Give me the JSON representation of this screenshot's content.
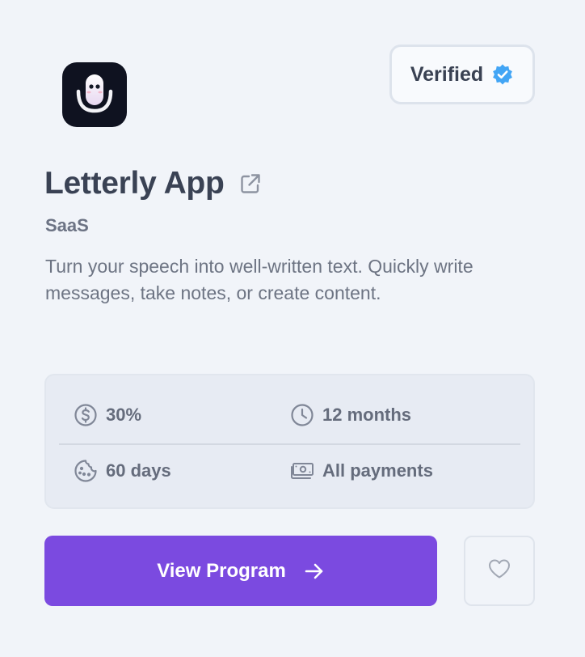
{
  "app": {
    "name": "Letterly App",
    "category": "SaaS",
    "description": "Turn your speech into well-written text. Quickly write messages, take notes, or create content.",
    "icon": "microphone-face-logo"
  },
  "badge": {
    "label": "Verified",
    "icon": "verified-check-icon",
    "icon_color": "#42a5f5"
  },
  "stats": {
    "commission": {
      "icon": "dollar-icon",
      "value": "30%"
    },
    "duration": {
      "icon": "clock-icon",
      "value": "12 months"
    },
    "cookie": {
      "icon": "cookie-icon",
      "value": "60 days"
    },
    "payments": {
      "icon": "cash-icon",
      "value": "All payments"
    }
  },
  "actions": {
    "view_label": "View Program",
    "view_icon": "arrow-right-icon",
    "fav_icon": "heart-icon"
  },
  "colors": {
    "accent": "#7b4ae0",
    "background": "#f1f4f9",
    "title": "#3a4254"
  }
}
